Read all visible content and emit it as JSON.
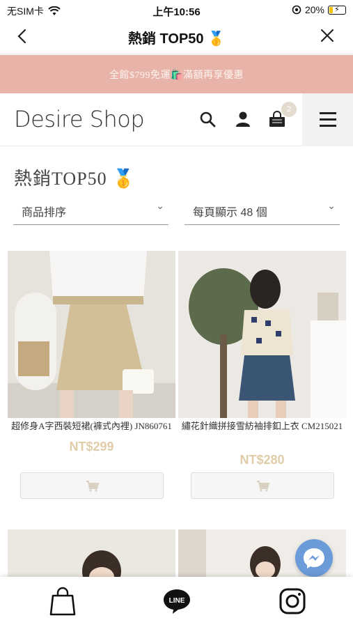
{
  "status_bar": {
    "carrier": "无SIM卡",
    "time": "上午10:56",
    "battery": "20%"
  },
  "nav": {
    "title": "熱銷 TOP50 🥇"
  },
  "promo": {
    "text": "全館$799免運🛍️滿額再享優惠"
  },
  "shop": {
    "logo": "Desire Shop",
    "cart_count": "2"
  },
  "page": {
    "title": "熱銷TOP50 🥇"
  },
  "filters": {
    "sort_label": "商品排序",
    "per_page_label": "每頁顯示 48 個"
  },
  "products": [
    {
      "name": "超修身A字西裝短裙(褲式內裡) JN860761",
      "price": "NT$299"
    },
    {
      "name": "繡花針織拼接雪紡袖排釦上衣 CM215021",
      "price": "NT$280"
    }
  ],
  "colors": {
    "promo_bg": "#e8b4a9",
    "price": "#e0cca8",
    "messenger": "#6b9bd8"
  },
  "bottom_bar": {
    "items": [
      "shopping-bag-icon",
      "line-icon",
      "instagram-icon"
    ]
  }
}
